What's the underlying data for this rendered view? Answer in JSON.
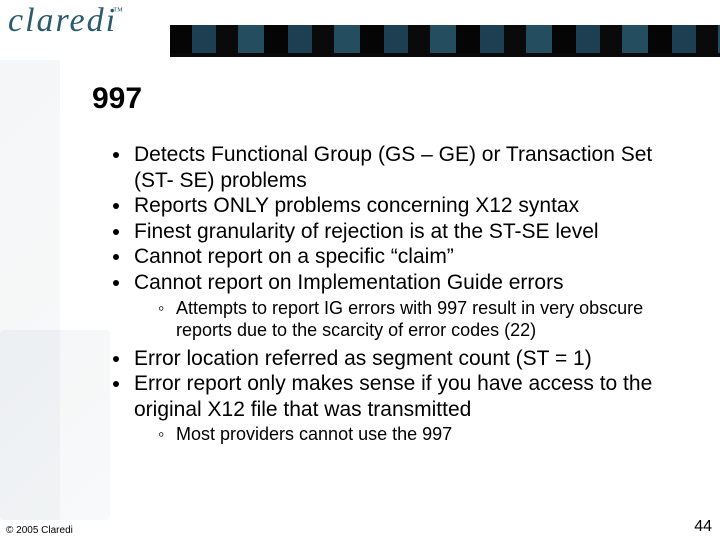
{
  "header": {
    "logo_text": "claredi",
    "logo_trademark": "™"
  },
  "title": "997",
  "bullets": [
    {
      "text": "Detects Functional Group (GS – GE) or Transaction Set (ST- SE) problems"
    },
    {
      "text": "Reports ONLY problems concerning X12 syntax"
    },
    {
      "text": "Finest granularity of rejection is at the ST-SE level"
    },
    {
      "text": "Cannot report on a specific “claim”"
    },
    {
      "text": "Cannot report on Implementation Guide errors",
      "sub": [
        "Attempts to report IG errors with 997 result in very obscure reports due to the scarcity of error codes (22)"
      ]
    },
    {
      "text": "Error location referred as segment count (ST = 1)"
    },
    {
      "text": "Error report only makes sense if you have access to the original X12 file that was transmitted",
      "sub": [
        "Most providers cannot use the 997"
      ]
    }
  ],
  "footer": {
    "copyright": "© 2005 Claredi",
    "page_number": "44"
  }
}
